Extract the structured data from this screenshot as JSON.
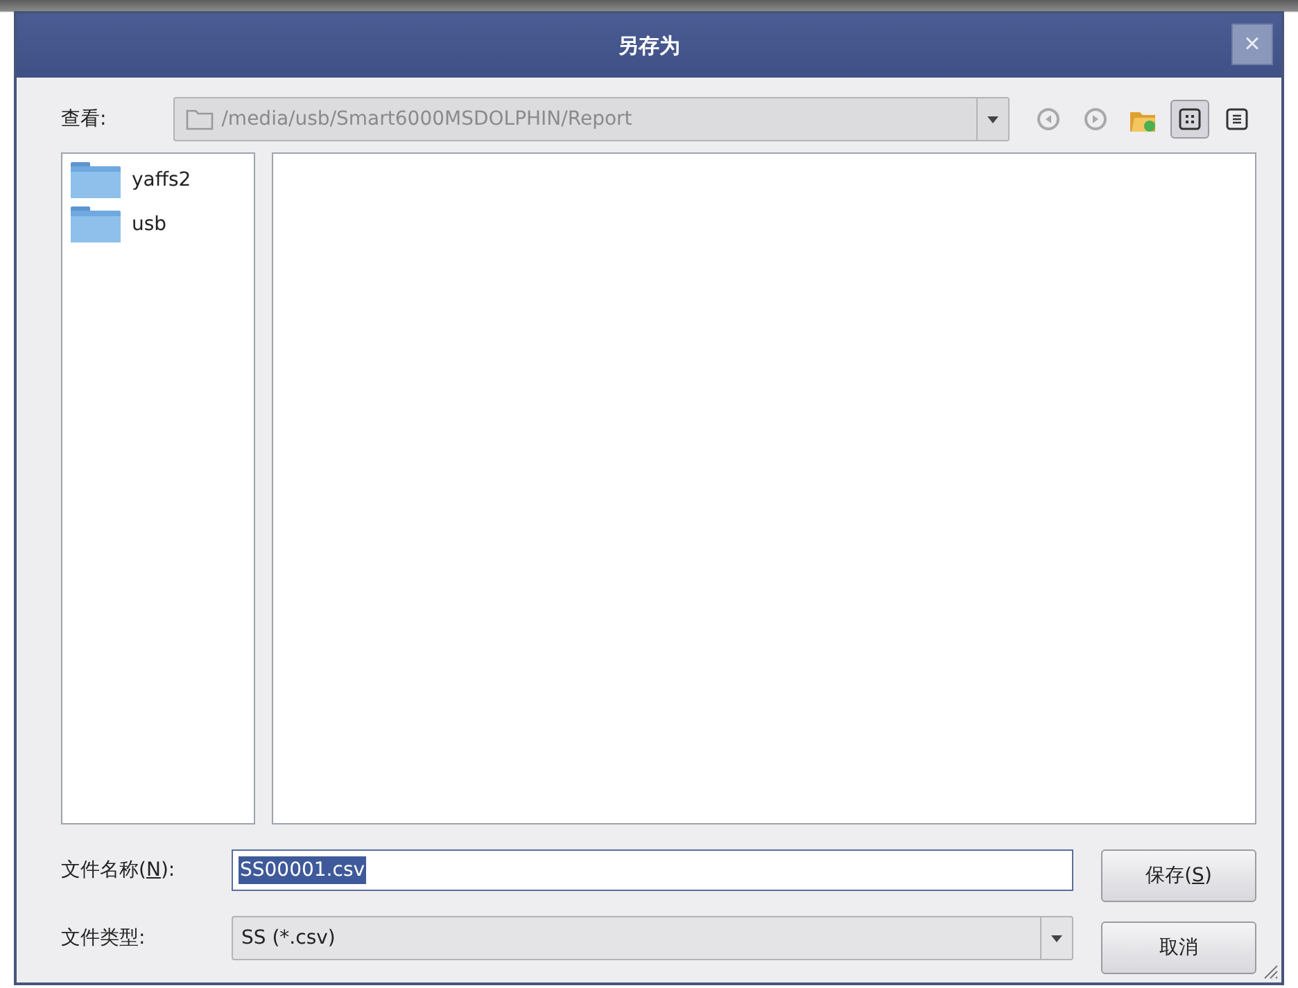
{
  "window": {
    "title": "另存为",
    "close": "×"
  },
  "look_in": {
    "label": "查看:",
    "path": "/media/usb/Smart6000MSDOLPHIN/Report",
    "disabled": true
  },
  "toolbar": [
    {
      "kind": "back",
      "disabled": true
    },
    {
      "kind": "forward",
      "disabled": true
    },
    {
      "kind": "new-folder",
      "disabled": false
    },
    {
      "kind": "icon-view",
      "selected": true
    },
    {
      "kind": "detail-view",
      "selected": false
    }
  ],
  "sidebar": {
    "items": [
      {
        "label": "yaffs2"
      },
      {
        "label": "usb"
      }
    ]
  },
  "file_name": {
    "label": {
      "before": "文件名称(",
      "mnemonic": "N",
      "after": "):"
    },
    "value": "SS00001.csv",
    "text_selected": true
  },
  "file_type": {
    "label": "文件类型:",
    "value": "SS (*.csv)"
  },
  "buttons": [
    {
      "label": {
        "before": "保存(",
        "mnemonic": "S",
        "after": ")"
      }
    },
    {
      "label": {
        "before": "取消"
      }
    }
  ]
}
